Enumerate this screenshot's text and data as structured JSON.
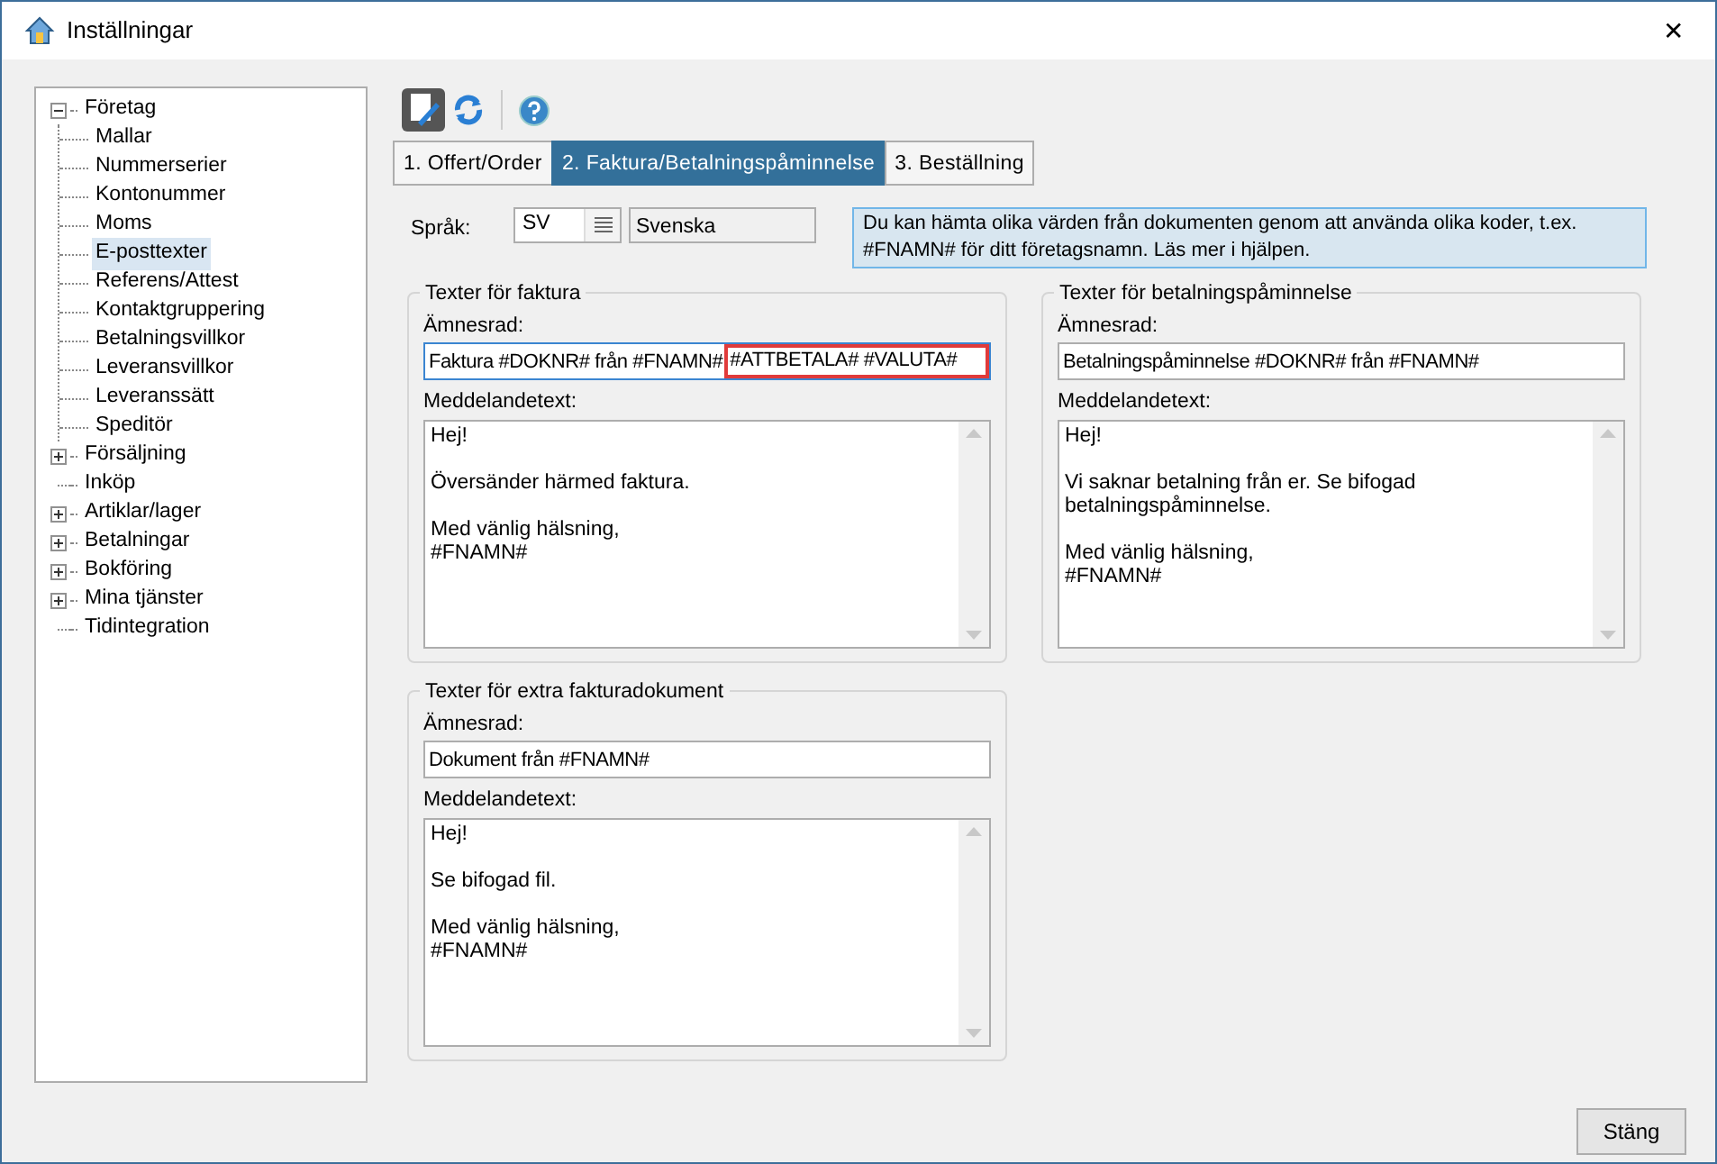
{
  "window": {
    "title": "Inställningar",
    "close": "✕"
  },
  "tree": [
    {
      "label": "Företag",
      "expanded": true,
      "selected": false,
      "children": [
        {
          "label": "Mallar",
          "selected": false
        },
        {
          "label": "Nummerserier",
          "selected": false
        },
        {
          "label": "Kontonummer",
          "selected": false
        },
        {
          "label": "Moms",
          "selected": false
        },
        {
          "label": "E-posttexter",
          "selected": true
        },
        {
          "label": "Referens/Attest",
          "selected": false
        },
        {
          "label": "Kontaktgruppering",
          "selected": false
        },
        {
          "label": "Betalningsvillkor",
          "selected": false
        },
        {
          "label": "Leveransvillkor",
          "selected": false
        },
        {
          "label": "Leveranssätt",
          "selected": false
        },
        {
          "label": "Speditör",
          "selected": false
        }
      ]
    },
    {
      "label": "Försäljning",
      "expanded": false,
      "selected": false
    },
    {
      "label": "Inköp",
      "selected": false
    },
    {
      "label": "Artiklar/lager",
      "expanded": false,
      "selected": false
    },
    {
      "label": "Betalningar",
      "expanded": false,
      "selected": false
    },
    {
      "label": "Bokföring",
      "expanded": false,
      "selected": false
    },
    {
      "label": "Mina tjänster",
      "expanded": false,
      "selected": false
    },
    {
      "label": "Tidintegration",
      "selected": false
    }
  ],
  "tabs": [
    {
      "label": "1. Offert/Order",
      "selected": false
    },
    {
      "label": "2. Faktura/Betalningspåminnelse",
      "selected": true
    },
    {
      "label": "3. Beställning",
      "selected": false
    }
  ],
  "language": {
    "label": "Språk:",
    "code": "SV",
    "name": "Svenska"
  },
  "info": "Du kan hämta olika värden från dokumenten genom att använda olika koder, t.ex. #FNAMN# för ditt företagsnamn. Läs mer i hjälpen.",
  "groups": [
    {
      "title": "Texter för faktura",
      "subject_label": "Ämnesrad:",
      "focused": true,
      "subject_parts": [
        {
          "text": "Faktura #DOKNR# från #FNAMN#",
          "highlighted": false
        },
        {
          "text": "#ATTBETALA# #VALUTA#",
          "highlighted": true
        }
      ],
      "message_label": "Meddelandetext:",
      "message": "Hej!\n\nÖversänder härmed faktura.\n\nMed vänlig hälsning,\n#FNAMN#"
    },
    {
      "title": "Texter för betalningspåminnelse",
      "subject_label": "Ämnesrad:",
      "focused": false,
      "subject_parts": [
        {
          "text": "Betalningspåminnelse #DOKNR# från #FNAMN#",
          "highlighted": false
        }
      ],
      "message_label": "Meddelandetext:",
      "message": "Hej!\n\nVi saknar betalning från er. Se bifogad betalningspåminnelse.\n\nMed vänlig hälsning,\n#FNAMN#"
    },
    {
      "title": "Texter för extra fakturadokument",
      "subject_label": "Ämnesrad:",
      "focused": false,
      "subject_parts": [
        {
          "text": "Dokument från #FNAMN#",
          "highlighted": false
        }
      ],
      "message_label": "Meddelandetext:",
      "message": "Hej!\n\nSe bifogad fil.\n\nMed vänlig hälsning,\n#FNAMN#"
    }
  ],
  "close_button": "Stäng"
}
